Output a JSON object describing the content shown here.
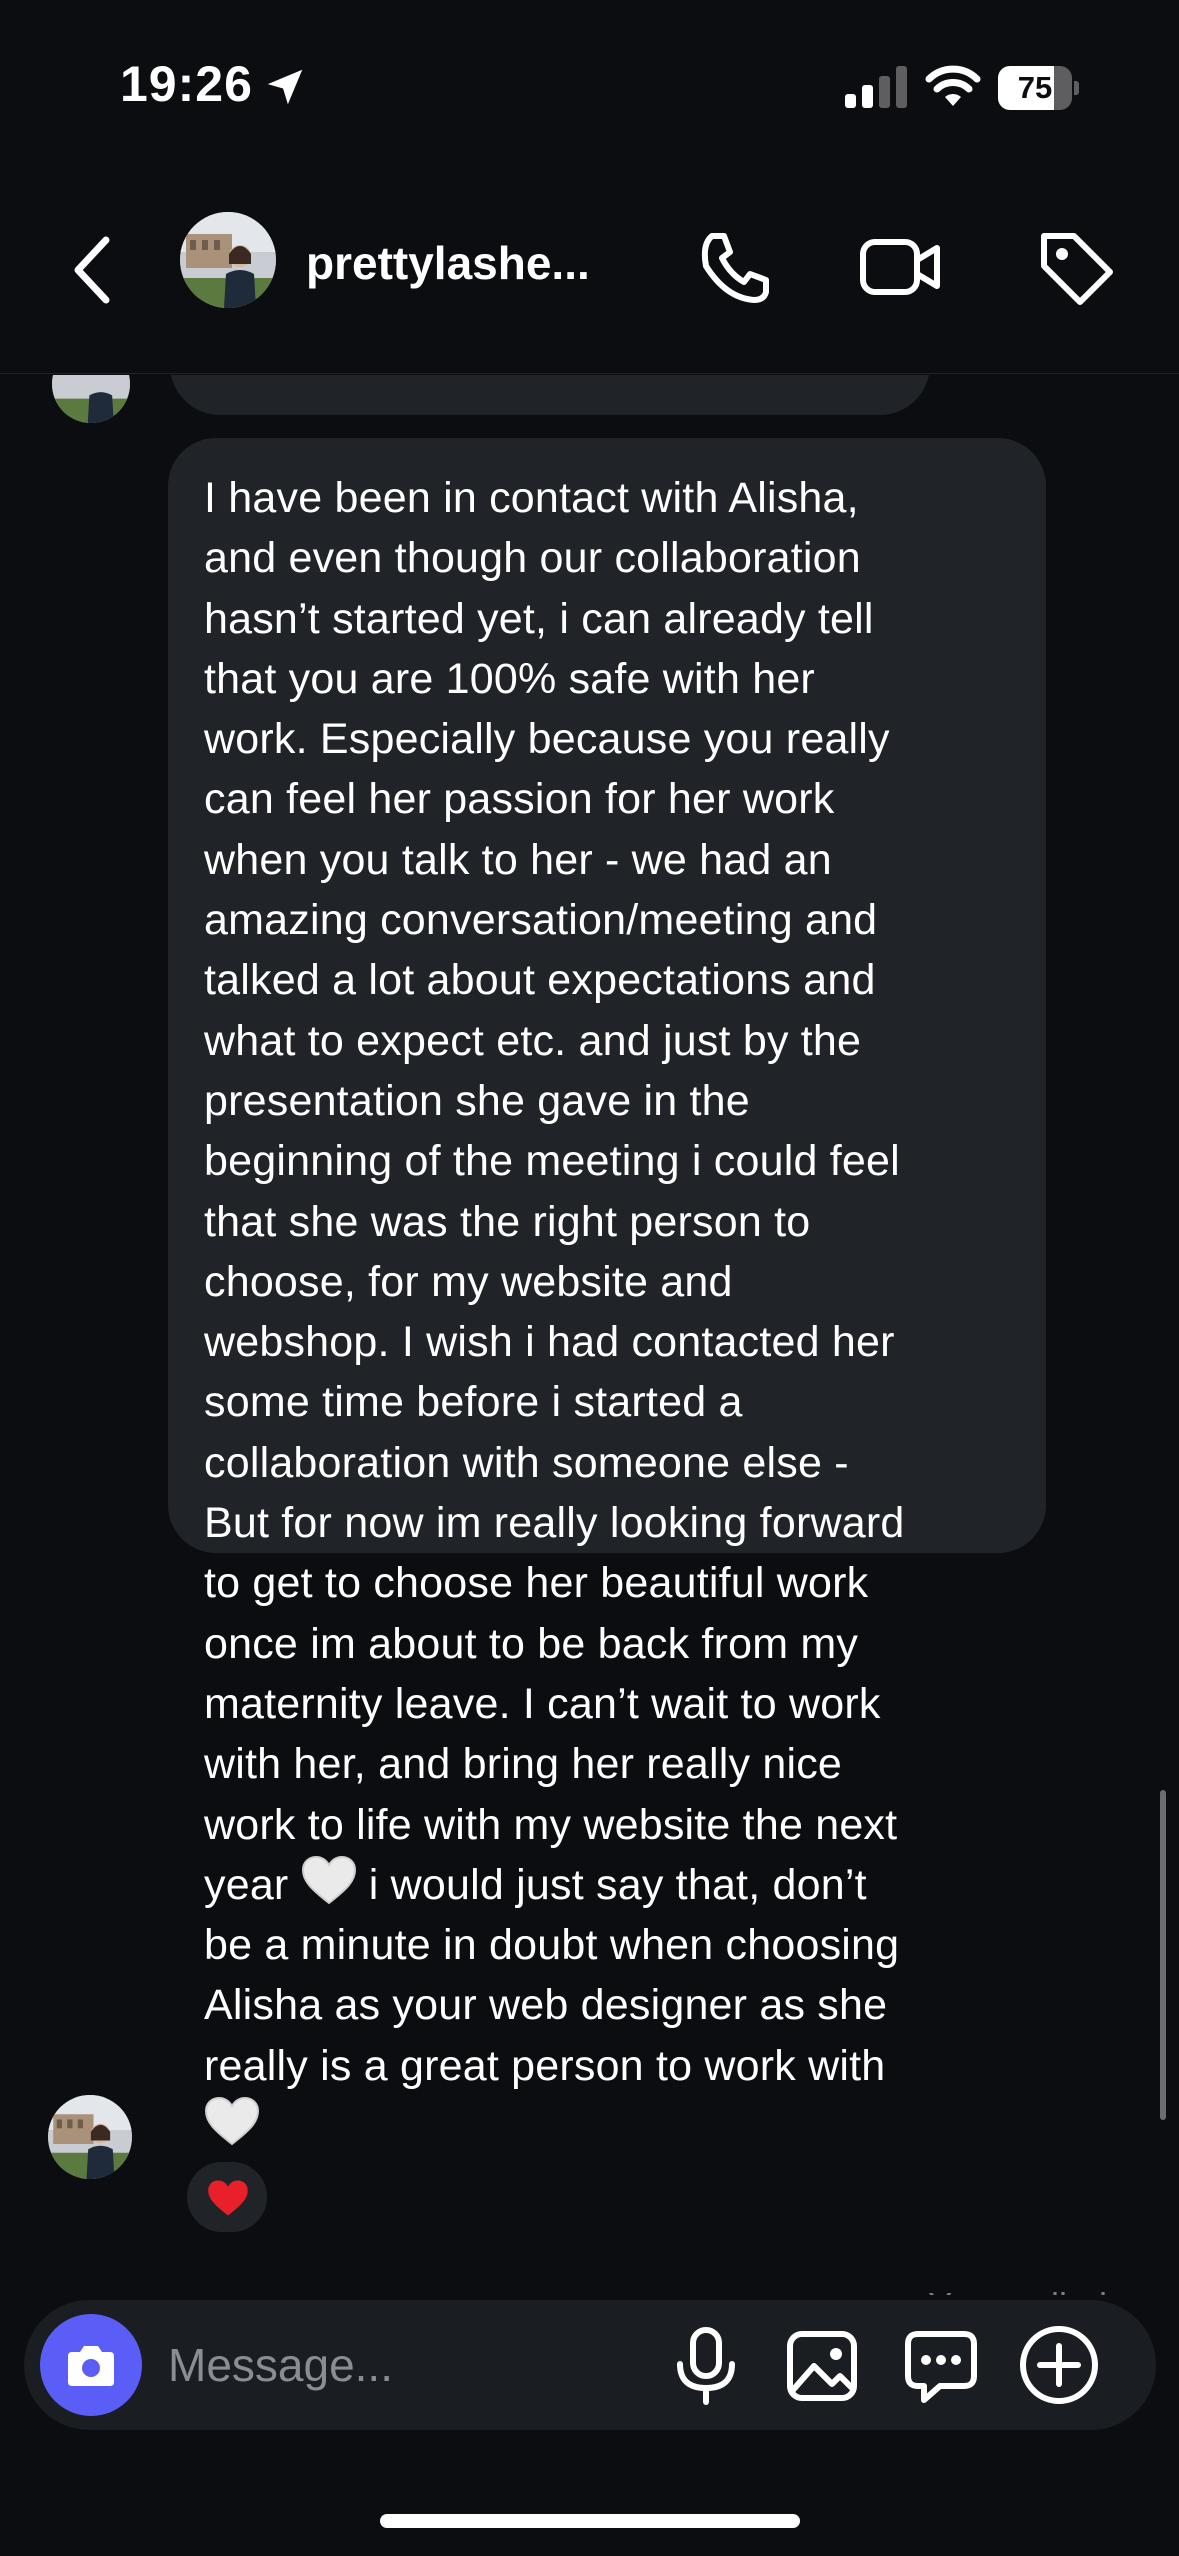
{
  "status_bar": {
    "time": "19:26",
    "battery": "75",
    "battery_level": 0.75
  },
  "header": {
    "name": "prettylashe..."
  },
  "message": {
    "lines": [
      "I have been in contact with Alisha,",
      "and even though our collaboration",
      "hasn’t started yet, i can already tell",
      "that you are 100% safe with her",
      "work. Especially because you really",
      "can feel her passion for her work",
      "when you talk to her - we had an",
      "amazing conversation/meeting and",
      "talked a lot about expectations and",
      "what to expect etc. and just by the",
      "presentation she gave in the",
      "beginning of the meeting i could feel",
      "that she was the right person to",
      "choose, for my website and",
      "webshop. I wish i had contacted her",
      "some time before i started a",
      "collaboration with someone else -",
      "But for now im really looking forward",
      "to get to choose her beautiful work",
      "once im about to be back from my",
      "maternity leave. I can’t wait to work",
      "with her, and bring her really nice",
      "work to life with my website the next"
    ],
    "line_year_before": "year",
    "line_year_after": "i would just say that, don’t",
    "lines_end": [
      "be a minute in doubt when choosing",
      "Alisha as your web designer as she",
      "really is a great person to work with"
    ],
    "reaction_icon": "red-heart-icon"
  },
  "you_replied": "You replied",
  "composer": {
    "placeholder": "Message..."
  },
  "colors": {
    "background": "#0b0d10",
    "bubble": "#202428",
    "accent": "#5b5ef6"
  }
}
